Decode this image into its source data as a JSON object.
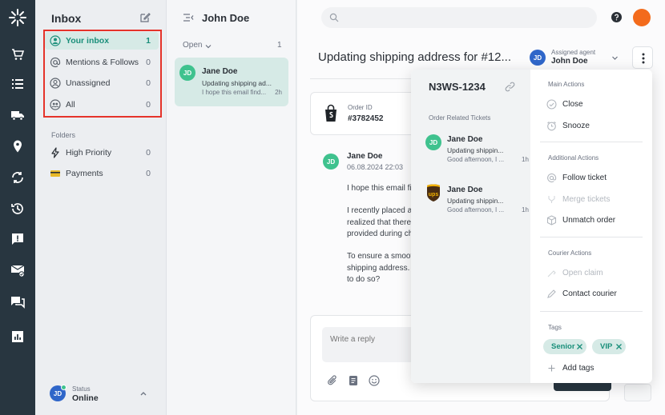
{
  "sidebar": {
    "title": "Inbox",
    "items": [
      {
        "label": "Your inbox",
        "count": "1"
      },
      {
        "label": "Mentions & Follows",
        "count": "0"
      },
      {
        "label": "Unassigned",
        "count": "0"
      },
      {
        "label": "All",
        "count": "0"
      }
    ],
    "folders_label": "Folders",
    "folders": [
      {
        "label": "High Priority",
        "count": "0"
      },
      {
        "label": "Payments",
        "count": "0"
      }
    ],
    "status": {
      "initials": "JD",
      "label": "Status",
      "value": "Online"
    }
  },
  "convlist": {
    "title": "John Doe",
    "filter": "Open",
    "count": "1",
    "card": {
      "initials": "JD",
      "name": "Jane Doe",
      "subject": "Updating shipping ad...",
      "preview": "I hope this email find...",
      "time": "2h"
    }
  },
  "main": {
    "ticket_title": "Updating shipping address for #12...",
    "agent": {
      "label": "Assigned agent",
      "name": "John Doe",
      "initials": "JD"
    },
    "order": {
      "label": "Order ID",
      "value": "#3782452"
    },
    "message": {
      "initials": "JD",
      "name": "Jane Doe",
      "time": "06.08.2024   22:03",
      "lines": [
        "I hope this email fi",
        "I recently placed a",
        "realized that there",
        "provided during ch",
        "To ensure a smoot",
        "shipping address.",
        "to do so?"
      ]
    },
    "reply_placeholder": "Write a reply"
  },
  "dropdown": {
    "ticket_id": "N3WS-1234",
    "related_label": "Order Related Tickets",
    "related": [
      {
        "initials": "JD",
        "name": "Jane Doe",
        "subject": "Updating shippin...",
        "preview": "Good afternoon, I ...",
        "time": "1h"
      },
      {
        "name": "Jane Doe",
        "subject": "Updating shippin...",
        "preview": "Good afternoon, I ...",
        "time": "1h"
      }
    ],
    "main_actions_label": "Main Actions",
    "close_label": "Close",
    "snooze_label": "Snooze",
    "additional_label": "Additional Actions",
    "follow_label": "Follow ticket",
    "merge_label": "Merge tickets",
    "unmatch_label": "Unmatch order",
    "courier_label": "Courier Actions",
    "open_claim_label": "Open claim",
    "contact_courier_label": "Contact courier",
    "tags_label": "Tags",
    "tags": [
      "Senior",
      "VIP"
    ],
    "add_tags_label": "Add tags"
  },
  "colors": {
    "accent": "#1a8f7a",
    "rail": "#283640",
    "highlight": "#e5332a",
    "user_avatar": "#f36b1c",
    "agent_avatar": "#2f66c9"
  }
}
